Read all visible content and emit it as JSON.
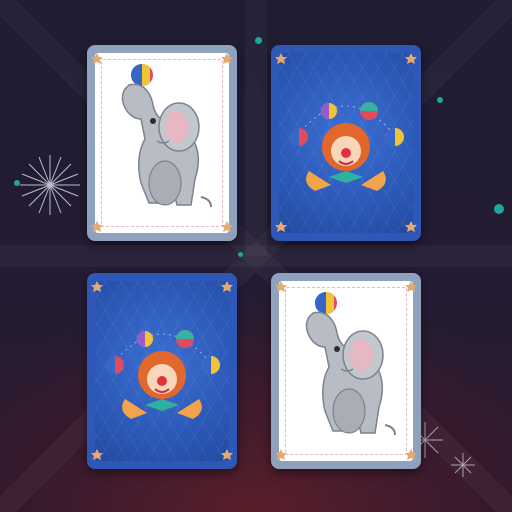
{
  "game": {
    "type": "memory-match",
    "cards": [
      {
        "slot": 1,
        "face": "elephant-with-ball",
        "state": "face-up"
      },
      {
        "slot": 2,
        "face": "card-back-clown-juggler",
        "state": "face-down"
      },
      {
        "slot": 3,
        "face": "card-back-clown-juggler",
        "state": "face-down"
      },
      {
        "slot": 4,
        "face": "elephant-with-ball",
        "state": "face-up"
      }
    ]
  },
  "colors": {
    "background": "#231c33",
    "card_back": "#2d58b8",
    "card_front_frame": "#8fa2bd",
    "accent_teal": "#1fa59a"
  },
  "icons": [
    "star-corner-icon",
    "elephant-icon",
    "clown-icon",
    "juggling-ball-icon",
    "firework-icon"
  ]
}
